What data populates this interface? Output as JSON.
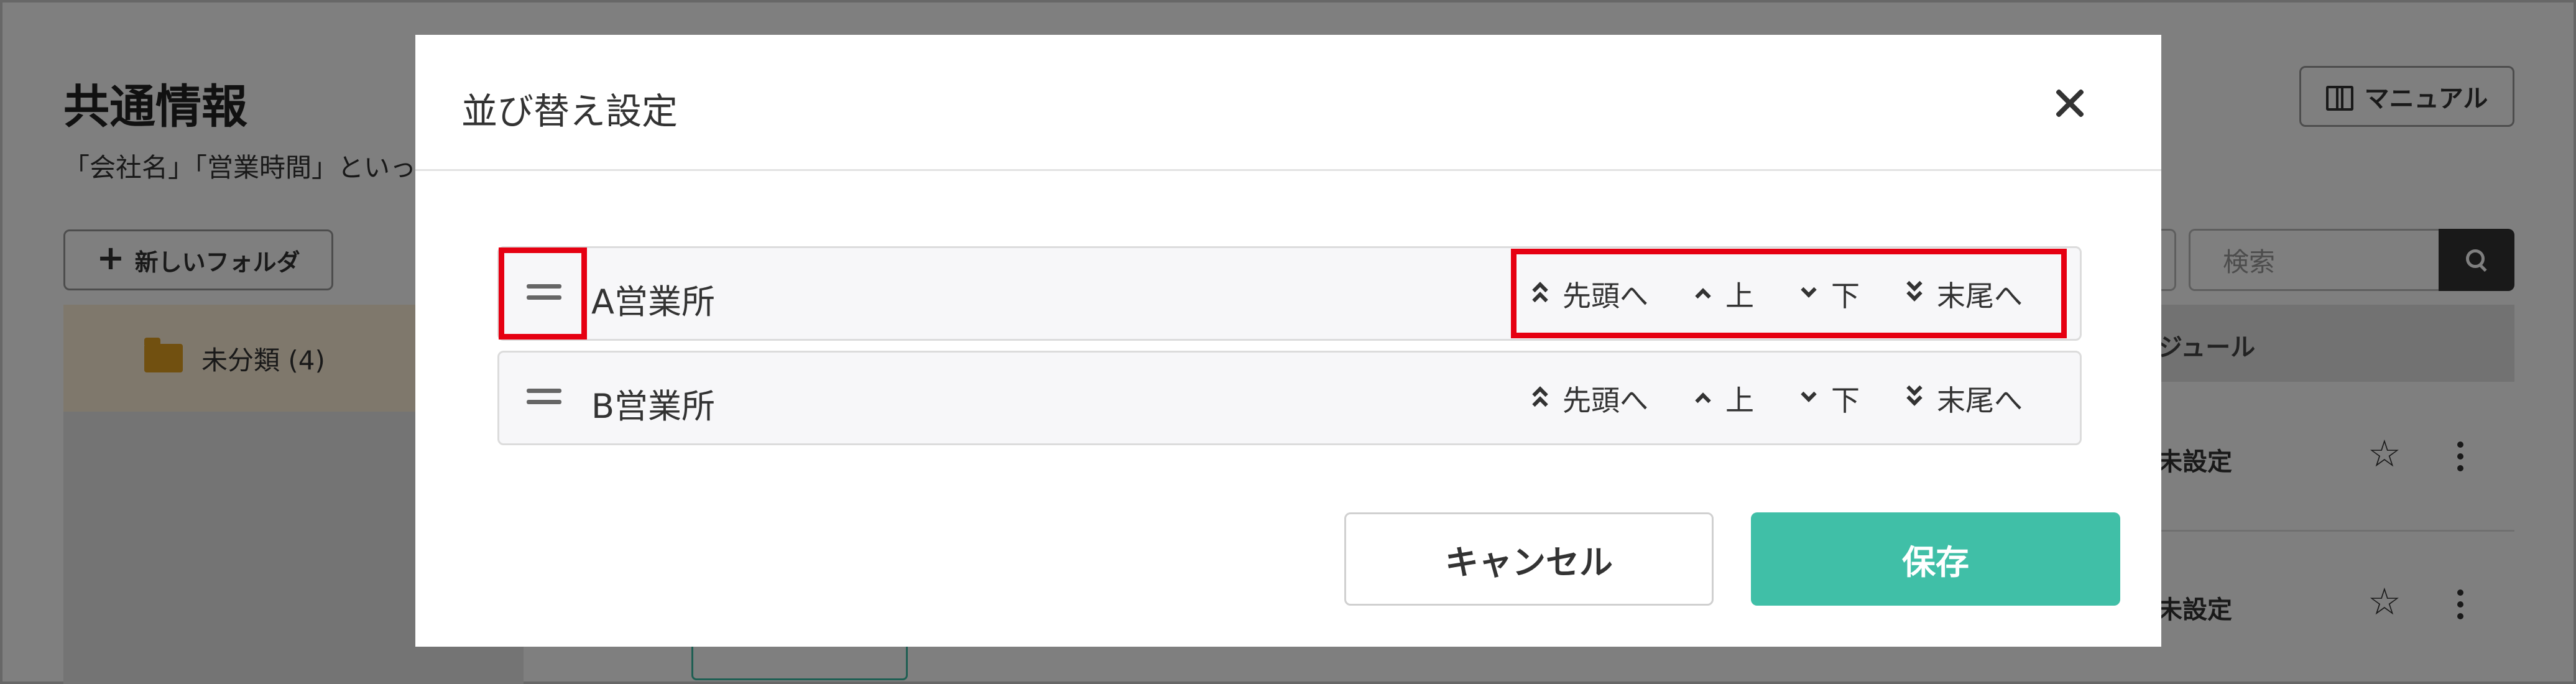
{
  "background": {
    "page_title": "共通情報",
    "page_description": "「会社名」「営業時間」といっ",
    "manual_button": "マニュアル",
    "new_folder_button": "新しいフォルダ",
    "folder_item": "未分類 (4)",
    "search_placeholder": "検索",
    "column_module": "ジュール",
    "rows": [
      {
        "status": "未設定"
      },
      {
        "status": "未設定"
      }
    ]
  },
  "modal": {
    "title": "並び替え設定",
    "items": [
      {
        "label": "A営業所",
        "actions": {
          "top": "先頭へ",
          "up": "上",
          "down": "下",
          "bottom": "末尾へ"
        }
      },
      {
        "label": "B営業所",
        "actions": {
          "top": "先頭へ",
          "up": "上",
          "down": "下",
          "bottom": "末尾へ"
        }
      }
    ],
    "cancel_button": "キャンセル",
    "save_button": "保存"
  },
  "colors": {
    "accent": "#40bfa7",
    "highlight": "#e60012",
    "folder": "#e3a020"
  }
}
